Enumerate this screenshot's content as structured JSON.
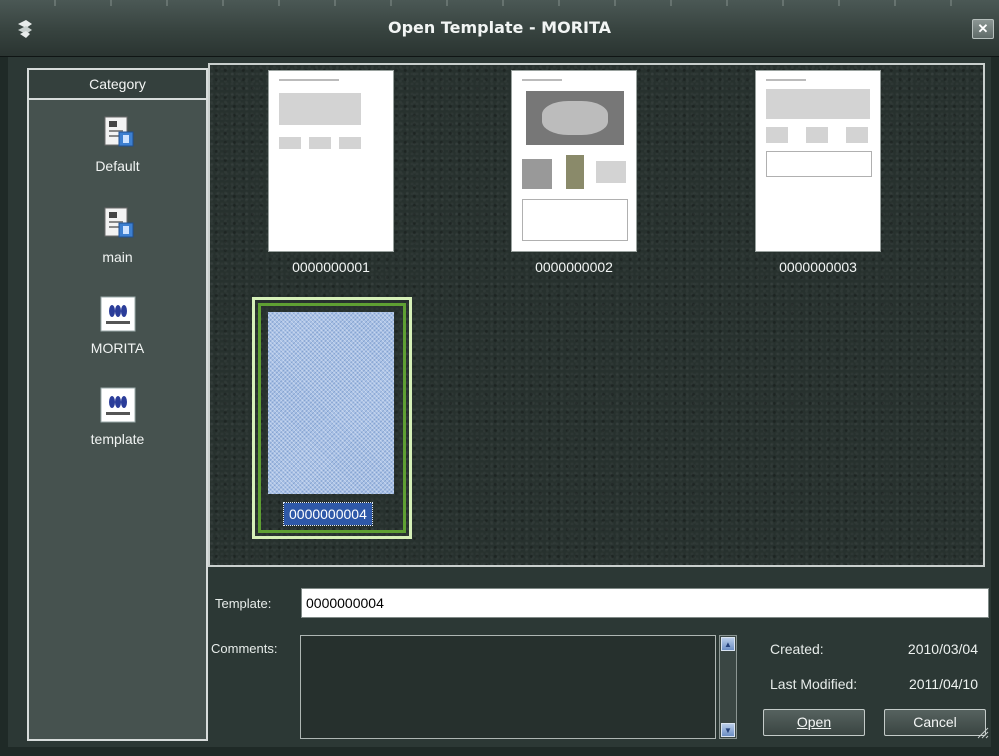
{
  "window": {
    "title": "Open Template - MORITA",
    "close_label": "✕"
  },
  "category": {
    "header": "Category",
    "items": [
      {
        "label": "Default",
        "icon": "document-icon"
      },
      {
        "label": "main",
        "icon": "document-icon"
      },
      {
        "label": "MORITA",
        "icon": "morita-logo-icon"
      },
      {
        "label": "template",
        "icon": "morita-logo-icon"
      }
    ]
  },
  "templates": [
    {
      "name": "0000000001",
      "selected": false
    },
    {
      "name": "0000000002",
      "selected": false
    },
    {
      "name": "0000000003",
      "selected": false
    },
    {
      "name": "0000000004",
      "selected": true
    }
  ],
  "form": {
    "template_label": "Template:",
    "template_value": "0000000004",
    "comments_label": "Comments:",
    "comments_value": "",
    "created_label": "Created:",
    "created_value": "2010/03/04",
    "modified_label": "Last Modified:",
    "modified_value": "2011/04/10"
  },
  "buttons": {
    "open": "Open",
    "cancel": "Cancel"
  },
  "colors": {
    "selection_border": "#5fa033",
    "selection_text_bg": "#2e58a8"
  }
}
